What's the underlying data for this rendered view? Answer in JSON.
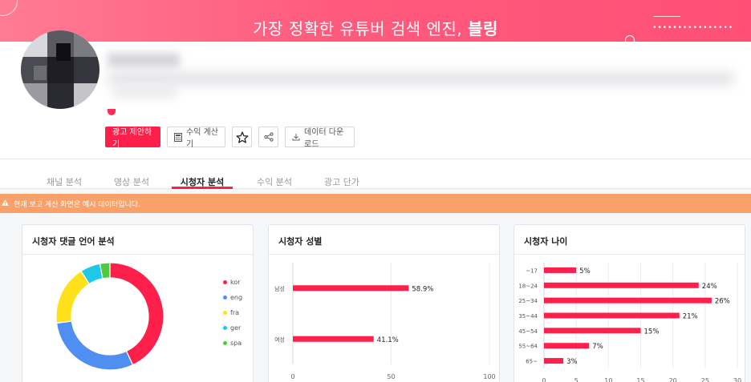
{
  "banner": {
    "title_prefix": "가장 정확한 유튜버 검색 엔진, ",
    "title_bold": "블링",
    "decoration": "••••••••••••••••"
  },
  "colors": {
    "accent": "#ff1f4b",
    "notice": "#f9a168",
    "kor": "#ff1f4b",
    "eng": "#4f8ff2",
    "fra": "#ffe01b",
    "ger": "#1ec8e8",
    "spa": "#4ecb3d"
  },
  "actions": {
    "ad_proposal": "광고 제안하기",
    "revenue_calc": "수익 계산기",
    "data_download": "데이터 다운로드",
    "icons": [
      "calculator-icon",
      "star-icon",
      "share-icon",
      "download-icon"
    ]
  },
  "tabs": [
    {
      "label": "채널 분석",
      "active": false
    },
    {
      "label": "영상 분석",
      "active": false
    },
    {
      "label": "시청자 분석",
      "active": true
    },
    {
      "label": "수익 분석",
      "active": false
    },
    {
      "label": "광고 단가",
      "active": false
    }
  ],
  "notice": {
    "text": "현재 보고 계신 화면은 예시 데이터입니다."
  },
  "cards": {
    "language": {
      "title": "시청자 댓글 언어 분석"
    },
    "gender": {
      "title": "시청자 성별"
    },
    "age": {
      "title": "시청자 나이"
    }
  },
  "chart_data": [
    {
      "type": "pie",
      "title": "시청자 댓글 언어 분석",
      "donut": true,
      "legend_position": "right",
      "categories": [
        "kor",
        "eng",
        "fra",
        "ger",
        "spa"
      ],
      "values": [
        43,
        30,
        18,
        6,
        3
      ]
    },
    {
      "type": "bar",
      "orientation": "horizontal",
      "title": "시청자 성별",
      "categories": [
        "남성",
        "여성"
      ],
      "values": [
        58.9,
        41.1
      ],
      "value_labels": [
        "58.9%",
        "41.1%"
      ],
      "xlim": [
        0,
        100
      ],
      "xticks": [
        0,
        50,
        100
      ],
      "grid": true
    },
    {
      "type": "bar",
      "orientation": "horizontal",
      "title": "시청자 나이",
      "categories": [
        "~17",
        "18~24",
        "25~34",
        "35~44",
        "45~54",
        "55~64",
        "65~"
      ],
      "values": [
        5,
        24,
        26,
        21,
        15,
        7,
        3
      ],
      "value_labels": [
        "5%",
        "24%",
        "26%",
        "21%",
        "15%",
        "7%",
        "3%"
      ],
      "xlim": [
        0,
        30
      ],
      "xticks": [
        0,
        5,
        10,
        15,
        20,
        25,
        30
      ],
      "grid": true
    }
  ]
}
